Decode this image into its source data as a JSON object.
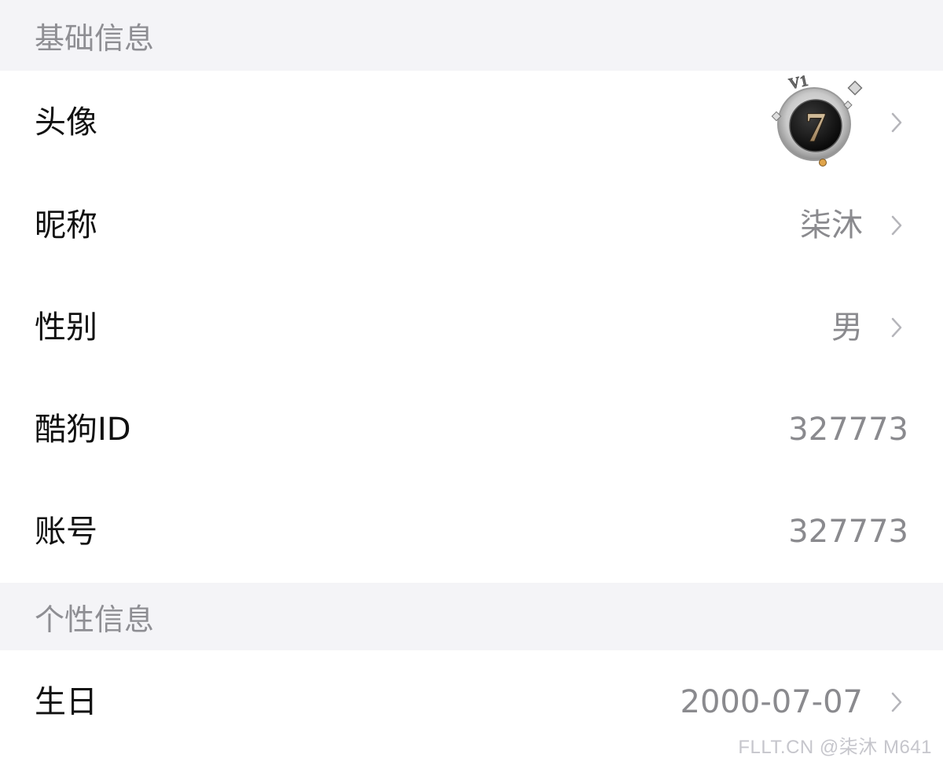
{
  "sections": {
    "basic": {
      "title": "基础信息",
      "avatar_label": "头像",
      "nickname_label": "昵称",
      "nickname_value": "柒沐",
      "gender_label": "性别",
      "gender_value": "男",
      "kugou_id_label": "酷狗ID",
      "kugou_id_value": "327773",
      "account_label": "账号",
      "account_value": "327773"
    },
    "personal": {
      "title": "个性信息",
      "birthday_label": "生日",
      "birthday_value": "2000-07-07"
    }
  },
  "avatar": {
    "badge_text": "V1",
    "number_text": "7"
  },
  "watermark": "FLLT.CN @柒沐 M641",
  "icons": {
    "chevron": "chevron-right-icon"
  },
  "colors": {
    "section_bg": "#f4f4f7",
    "section_text": "#8e8e93",
    "label_text": "#111111",
    "value_text": "#8a8a8e",
    "chevron": "#b5b5ba"
  }
}
